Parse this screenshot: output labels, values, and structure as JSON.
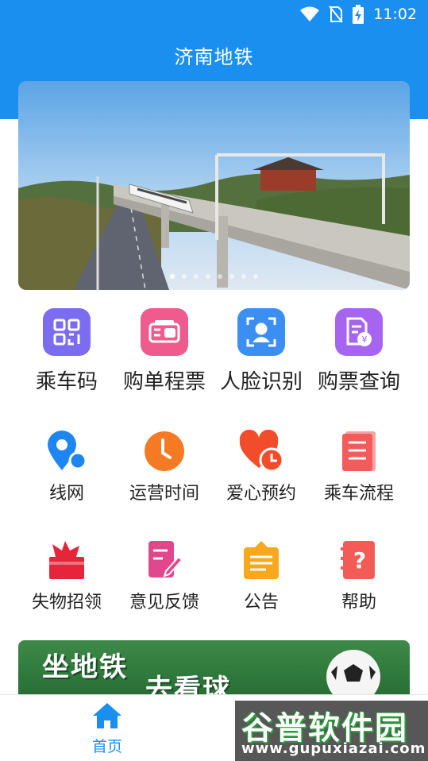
{
  "status_bar": {
    "time": "11:02",
    "icons": [
      "wifi-icon",
      "no-sim-icon",
      "battery-charging-icon"
    ]
  },
  "header": {
    "title": "济南地铁"
  },
  "banner": {
    "image": "metro-train-on-elevated-track-photo",
    "slide_count": 8,
    "active_slide": 0
  },
  "features": [
    {
      "label": "乘车码",
      "icon": "qr-code-icon",
      "color": "#7b6cf0"
    },
    {
      "label": "购单程票",
      "icon": "ticket-icon",
      "color": "#ef5b8c"
    },
    {
      "label": "人脸识别",
      "icon": "face-scan-icon",
      "color": "#3b8ff3"
    },
    {
      "label": "购票查询",
      "icon": "ticket-query-icon",
      "color": "#a764f0"
    }
  ],
  "services_row1": [
    {
      "label": "线网",
      "icon": "map-pin-icon",
      "color": "#1e86f0"
    },
    {
      "label": "运营时间",
      "icon": "clock-icon",
      "color": "#f47a24"
    },
    {
      "label": "爱心预约",
      "icon": "heart-clock-icon",
      "color": "#f24d2b"
    },
    {
      "label": "乘车流程",
      "icon": "document-icon",
      "color": "#f45c5c"
    }
  ],
  "services_row2": [
    {
      "label": "失物招领",
      "icon": "lost-found-icon",
      "color": "#e8243b"
    },
    {
      "label": "意见反馈",
      "icon": "feedback-icon",
      "color": "#e2478d"
    },
    {
      "label": "公告",
      "icon": "announcement-icon",
      "color": "#f7a81c"
    },
    {
      "label": "帮助",
      "icon": "help-icon",
      "color": "#f35b56"
    }
  ],
  "promo": {
    "line1": "坐地铁",
    "line2": "去看球",
    "icon": "soccer-ball-icon"
  },
  "tabbar": {
    "home_label": "首页",
    "home_icon": "home-icon"
  },
  "watermark": {
    "brand": "谷普软件园",
    "url": "www.gupuxiazai.com"
  }
}
